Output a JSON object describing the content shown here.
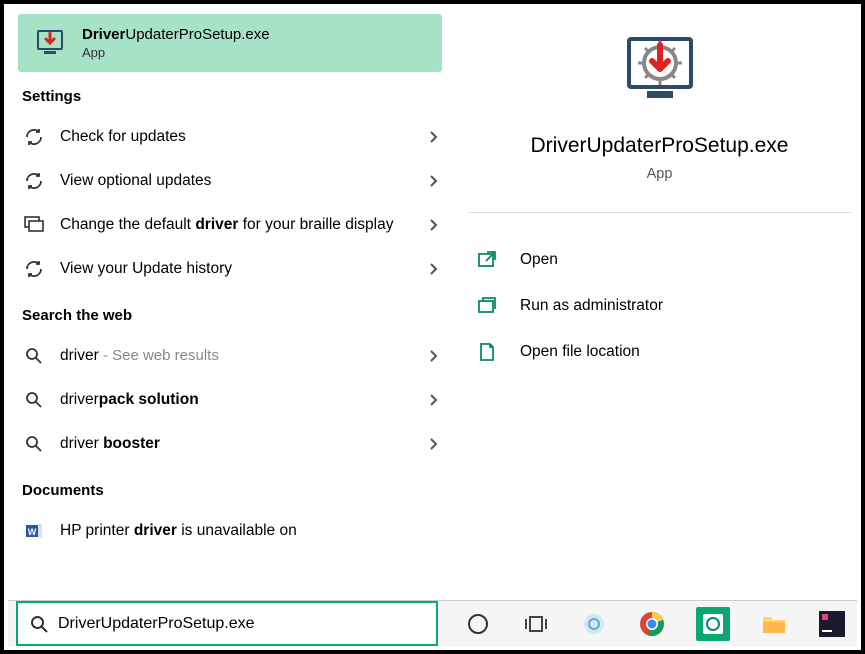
{
  "topResult": {
    "title_prefix": "Driver",
    "title_rest": "UpdaterProSetup.exe",
    "sub": "App"
  },
  "sections": {
    "settings_header": "Settings",
    "web_header": "Search the web",
    "docs_header": "Documents"
  },
  "settings_items": [
    {
      "text_before": "Check for updates",
      "bold": "",
      "text_after": ""
    },
    {
      "text_before": "View optional updates",
      "bold": "",
      "text_after": ""
    },
    {
      "text_before": "Change the default ",
      "bold": "driver",
      "text_after": " for your braille display"
    },
    {
      "text_before": "View your Update history",
      "bold": "",
      "text_after": ""
    }
  ],
  "web_items": [
    {
      "prefix": "driver",
      "bold": "",
      "suffix": "",
      "muted": " - See web results"
    },
    {
      "prefix": "driver",
      "bold": "pack solution",
      "suffix": "",
      "muted": ""
    },
    {
      "prefix": "driver ",
      "bold": "booster",
      "suffix": "",
      "muted": ""
    }
  ],
  "docs_items": [
    {
      "text_before": "HP printer ",
      "bold": "driver",
      "text_after": " is unavailable on"
    }
  ],
  "detail": {
    "title": "DriverUpdaterProSetup.exe",
    "sub": "App",
    "actions": {
      "open": "Open",
      "runadmin": "Run as administrator",
      "openloc": "Open file location"
    }
  },
  "search_value": "DriverUpdaterProSetup.exe"
}
